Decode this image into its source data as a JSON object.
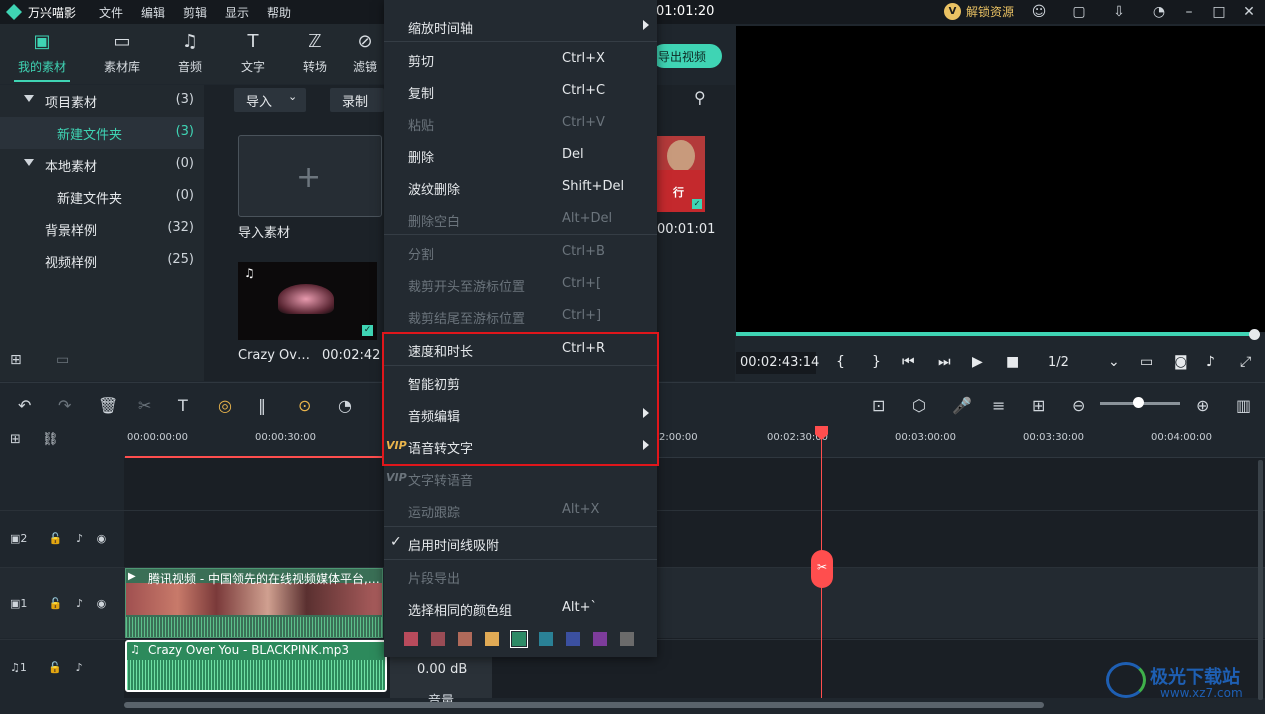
{
  "app": {
    "name": "万兴喵影",
    "menus": [
      "文件",
      "编辑",
      "剪辑",
      "显示",
      "帮助"
    ],
    "timecode": "01:01:20",
    "unlock_label": "解锁资源",
    "export_label": "导出视频"
  },
  "toolbar": {
    "items": [
      {
        "label": "我的素材",
        "icon": "folder-media-icon"
      },
      {
        "label": "素材库",
        "icon": "folder-icon"
      },
      {
        "label": "音频",
        "icon": "music-note-icon"
      },
      {
        "label": "文字",
        "icon": "text-icon"
      },
      {
        "label": "转场",
        "icon": "transition-icon"
      },
      {
        "label": "滤镜",
        "icon": "filter-icon"
      }
    ],
    "accent": "#3fd4b4"
  },
  "tree": {
    "items": [
      {
        "label": "项目素材",
        "count": "(3)"
      },
      {
        "label": "新建文件夹",
        "count": "(3)"
      },
      {
        "label": "本地素材",
        "count": "(0)"
      },
      {
        "label": "新建文件夹",
        "count": "(0)"
      },
      {
        "label": "背景样例",
        "count": "(32)"
      },
      {
        "label": "视频样例",
        "count": "(25)"
      }
    ]
  },
  "media": {
    "import_label": "导入",
    "record_label": "录制",
    "import_tile_label": "导入素材",
    "clip1_title": "Crazy Ov…",
    "clip1_duration": "00:02:42",
    "clip2_duration": "00:01:01",
    "clip2_badge": "行"
  },
  "preview": {
    "time": "00:02:43:14",
    "ratio": "1/2",
    "braces": [
      "{",
      "}"
    ]
  },
  "ruler": {
    "ticks": [
      "00:00:00:00",
      "00:00:30:00",
      "2:00:00",
      "00:02:30:00",
      "00:03:00:00",
      "00:03:30:00",
      "00:04:00:00"
    ]
  },
  "tracks": {
    "video_clip_title": "腾讯视频 - 中国领先的在线视频媒体平台,…",
    "audio_clip_title": "Crazy Over You - BLACKPINK.mp3",
    "volume": "0.00 dB",
    "volume_label": "音量",
    "v2": "2",
    "v1": "1",
    "a1": "1"
  },
  "context_menu": {
    "items": [
      {
        "label": "缩放时间轴",
        "shortcut": "",
        "disabled": false,
        "submenu": true
      },
      {
        "label": "剪切",
        "shortcut": "Ctrl+X",
        "disabled": false
      },
      {
        "label": "复制",
        "shortcut": "Ctrl+C",
        "disabled": false
      },
      {
        "label": "粘贴",
        "shortcut": "Ctrl+V",
        "disabled": true
      },
      {
        "label": "删除",
        "shortcut": "Del",
        "disabled": false
      },
      {
        "label": "波纹删除",
        "shortcut": "Shift+Del",
        "disabled": false
      },
      {
        "label": "删除空白",
        "shortcut": "Alt+Del",
        "disabled": true
      },
      {
        "label": "分割",
        "shortcut": "Ctrl+B",
        "disabled": true
      },
      {
        "label": "裁剪开头至游标位置",
        "shortcut": "Ctrl+[",
        "disabled": true
      },
      {
        "label": "裁剪结尾至游标位置",
        "shortcut": "Ctrl+]",
        "disabled": true
      },
      {
        "label": "速度和时长",
        "shortcut": "Ctrl+R",
        "disabled": false
      },
      {
        "label": "智能初剪",
        "shortcut": "",
        "disabled": false
      },
      {
        "label": "音频编辑",
        "shortcut": "",
        "disabled": false,
        "submenu": true
      },
      {
        "label": "语音转文字",
        "shortcut": "",
        "disabled": false,
        "submenu": true,
        "vip": "VIP"
      },
      {
        "label": "文字转语音",
        "shortcut": "",
        "disabled": true,
        "vip": "VIP"
      },
      {
        "label": "运动跟踪",
        "shortcut": "Alt+X",
        "disabled": true
      },
      {
        "label": "启用时间线吸附",
        "shortcut": "",
        "disabled": false,
        "checked": true
      },
      {
        "label": "片段导出",
        "shortcut": "",
        "disabled": true
      },
      {
        "label": "选择相同的颜色组",
        "shortcut": "Alt+`",
        "disabled": false
      }
    ],
    "swatches": [
      "#b84b5c",
      "#9a4c55",
      "#b06a5a",
      "#e0aa55",
      "#2e8a66",
      "#2a8196",
      "#3b50a0",
      "#7d3c9b",
      "#6b6b6b"
    ],
    "highlight_color": "#e0161b"
  },
  "watermark": {
    "text": "极光下载站",
    "url": "www.xz7.com"
  }
}
